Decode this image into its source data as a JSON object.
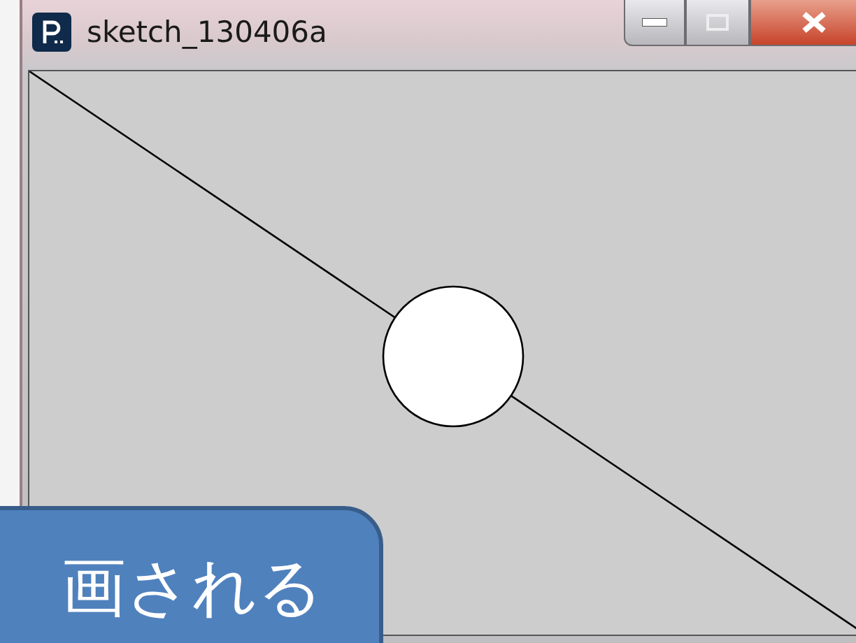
{
  "window": {
    "title": "sketch_130406a"
  },
  "callout": {
    "text": "画される"
  }
}
